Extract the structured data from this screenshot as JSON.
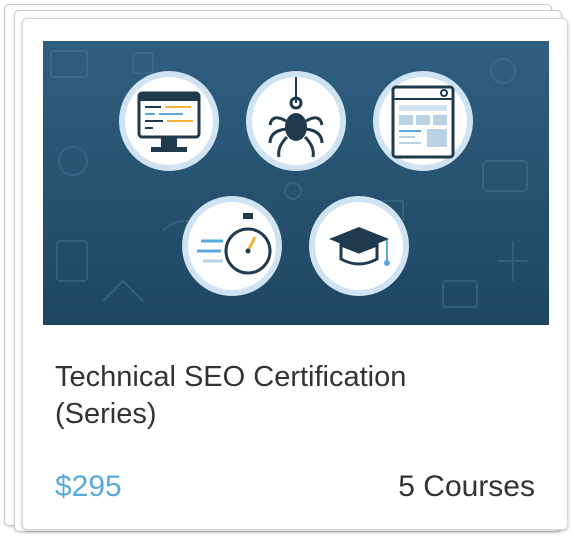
{
  "course": {
    "title_line1": "Technical SEO Certification",
    "title_line2": "(Series)",
    "price": "$295",
    "course_count": "5 Courses"
  },
  "icons": [
    "code-monitor-icon",
    "spider-icon",
    "web-page-icon",
    "stopwatch-icon",
    "graduation-cap-icon"
  ],
  "colors": {
    "banner_top": "#2e5d7d",
    "banner_bottom": "#1f4763",
    "circle_ring": "#cfe3f3",
    "accent_blue": "#5aa9dd",
    "accent_yellow": "#f5b335",
    "price": "#5aa9dd",
    "text": "#333333"
  }
}
